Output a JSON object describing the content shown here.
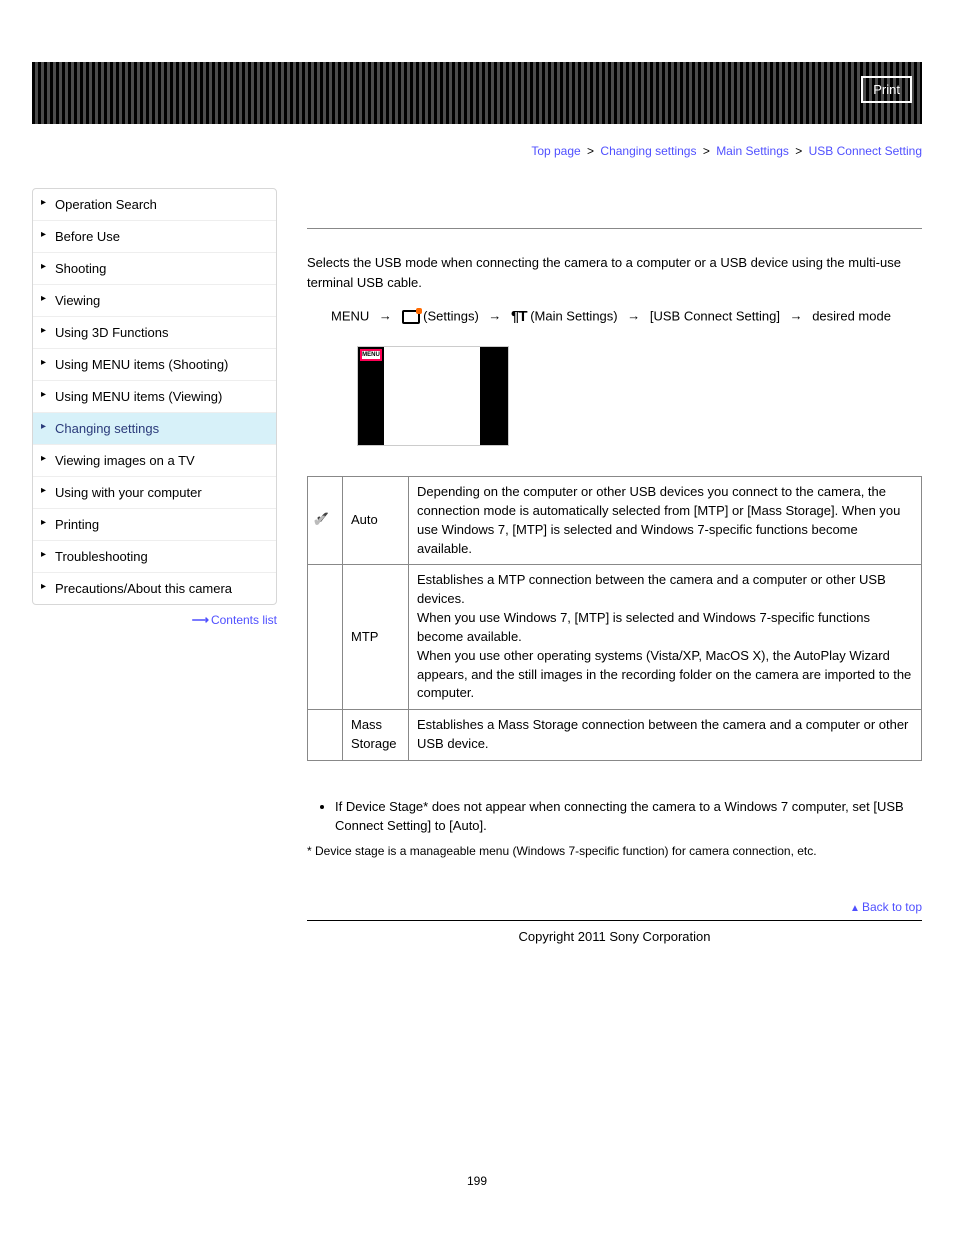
{
  "header": {
    "print_label": "Print"
  },
  "breadcrumb": {
    "top_page": "Top page",
    "changing_settings": "Changing settings",
    "main_settings": "Main Settings",
    "current": "USB Connect Setting"
  },
  "sidebar": {
    "items": [
      {
        "label": "Operation Search"
      },
      {
        "label": "Before Use"
      },
      {
        "label": "Shooting"
      },
      {
        "label": "Viewing"
      },
      {
        "label": "Using 3D Functions"
      },
      {
        "label": "Using MENU items (Shooting)"
      },
      {
        "label": "Using MENU items (Viewing)"
      },
      {
        "label": "Changing settings",
        "active": true
      },
      {
        "label": "Viewing images on a TV"
      },
      {
        "label": "Using with your computer"
      },
      {
        "label": "Printing"
      },
      {
        "label": "Troubleshooting"
      },
      {
        "label": "Precautions/About this camera"
      }
    ],
    "contents_list": "Contents list"
  },
  "main": {
    "intro": "Selects the USB mode when connecting the camera to a computer or a USB device using the multi-use terminal USB cable.",
    "step": {
      "menu": "MENU",
      "settings": "(Settings)",
      "main_settings": "(Main Settings)",
      "usb_connect": "[USB Connect Setting]",
      "desired_mode": "desired mode",
      "thumb_menu": "MENU"
    },
    "table": [
      {
        "checked": true,
        "mode": "Auto",
        "desc": "Depending on the computer or other USB devices you connect to the camera, the connection mode is automatically selected from [MTP] or [Mass Storage]. When you use Windows 7, [MTP] is selected and Windows 7-specific functions become available."
      },
      {
        "checked": false,
        "mode": "MTP",
        "desc": "Establishes a MTP connection between the camera and a computer or other USB devices.\nWhen you use Windows 7, [MTP] is selected and Windows 7-specific functions become available.\nWhen you use other operating systems (Vista/XP, MacOS X), the AutoPlay Wizard appears, and the still images in the recording folder on the camera are imported to the computer."
      },
      {
        "checked": false,
        "mode": "Mass Storage",
        "desc": "Establishes a Mass Storage connection between the camera and a computer or other USB device."
      }
    ],
    "note": "If Device Stage* does not appear when connecting the camera to a Windows 7 computer, set [USB Connect Setting] to [Auto].",
    "footnote": "* Device stage is a manageable menu (Windows 7-specific function) for camera connection, etc.",
    "back_to_top": "Back to top",
    "copyright": "Copyright 2011 Sony Corporation",
    "page_number": "199"
  }
}
